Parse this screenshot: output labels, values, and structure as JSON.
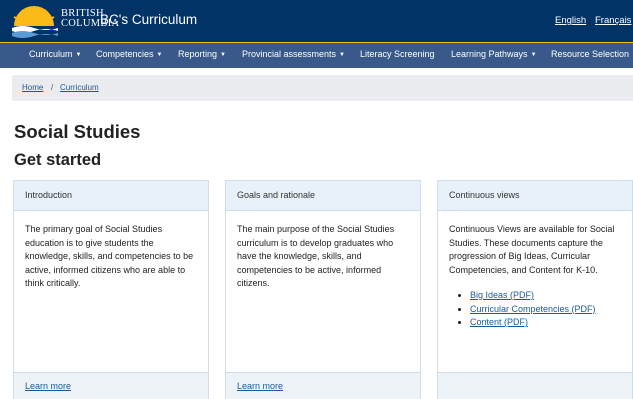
{
  "header": {
    "logo_line1": "BRITISH",
    "logo_line2": "COLUMBIA",
    "site_title": "BC's Curriculum",
    "lang_english": "English",
    "lang_french": "Français"
  },
  "nav": [
    {
      "label": "Curriculum",
      "dropdown": true
    },
    {
      "label": "Competencies",
      "dropdown": true
    },
    {
      "label": "Reporting",
      "dropdown": true
    },
    {
      "label": "Provincial assessments",
      "dropdown": true
    },
    {
      "label": "Literacy Screening",
      "dropdown": false
    },
    {
      "label": "Learning Pathways",
      "dropdown": true
    },
    {
      "label": "Resource Selection",
      "dropdown": false
    }
  ],
  "breadcrumb": {
    "home": "Home",
    "separator": "/",
    "current": "Curriculum"
  },
  "page_title": "Social Studies",
  "section_title": "Get started",
  "cards": [
    {
      "title": "Introduction",
      "text": "The primary goal of Social Studies education is to give students the knowledge, skills, and competencies to be active, informed citizens who are able to think critically.",
      "link": "Learn more"
    },
    {
      "title": "Goals and rationale",
      "text": "The main purpose of the Social Studies curriculum is to develop graduates who have the knowledge, skills, and competencies to be active, informed citizens.",
      "link": "Learn more"
    },
    {
      "title": "Continuous views",
      "text": "Continuous Views are available for Social Studies. These documents capture the progression of Big Ideas, Curricular Competencies, and Content for K-10.",
      "links": [
        "Big Ideas (PDF)",
        "Curricular Competencies (PDF)",
        "Content (PDF)"
      ],
      "link": ""
    }
  ],
  "colors": {
    "header_bg": "#013366",
    "nav_bg": "#38598a",
    "accent": "#fcba19",
    "link": "#1a5a96"
  }
}
